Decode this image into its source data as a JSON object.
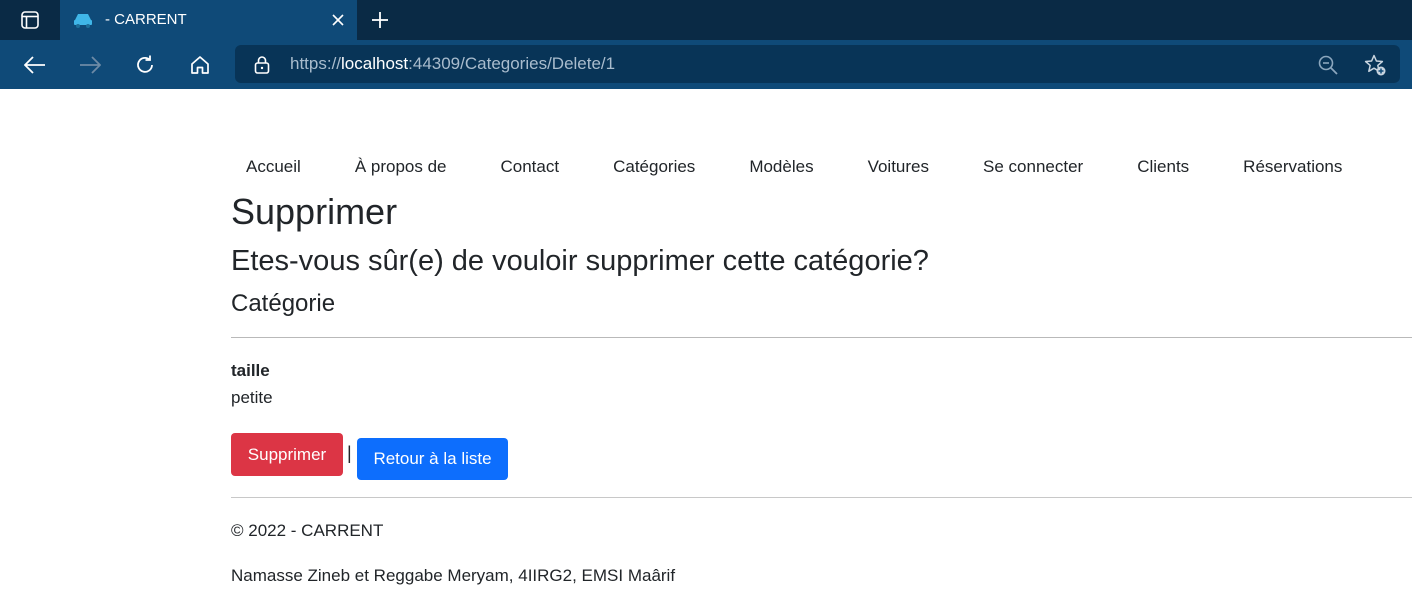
{
  "browser": {
    "tab_title": "- CARRENT",
    "url_scheme": "https://",
    "url_host": "localhost",
    "url_rest": ":44309/Categories/Delete/1"
  },
  "nav": {
    "items": [
      "Accueil",
      "À propos de",
      "Contact",
      "Catégories",
      "Modèles",
      "Voitures",
      "Se connecter",
      "Clients",
      "Réservations"
    ]
  },
  "page": {
    "title": "Supprimer",
    "question": "Etes-vous sûr(e) de vouloir supprimer cette catégorie?",
    "entity": "Catégorie",
    "field_label": "taille",
    "field_value": "petite",
    "delete_label": "Supprimer",
    "separator": "|",
    "back_label": "Retour à la liste"
  },
  "footer": {
    "copyright": "© 2022 - CARRENT",
    "authors": "Namasse Zineb et Reggabe Meryam, 4IIRG2, EMSI Maârif"
  },
  "colors": {
    "tabbar": "#0a2a45",
    "toolbar": "#0f4a78",
    "danger": "#dc3545",
    "primary": "#0d6efd"
  }
}
